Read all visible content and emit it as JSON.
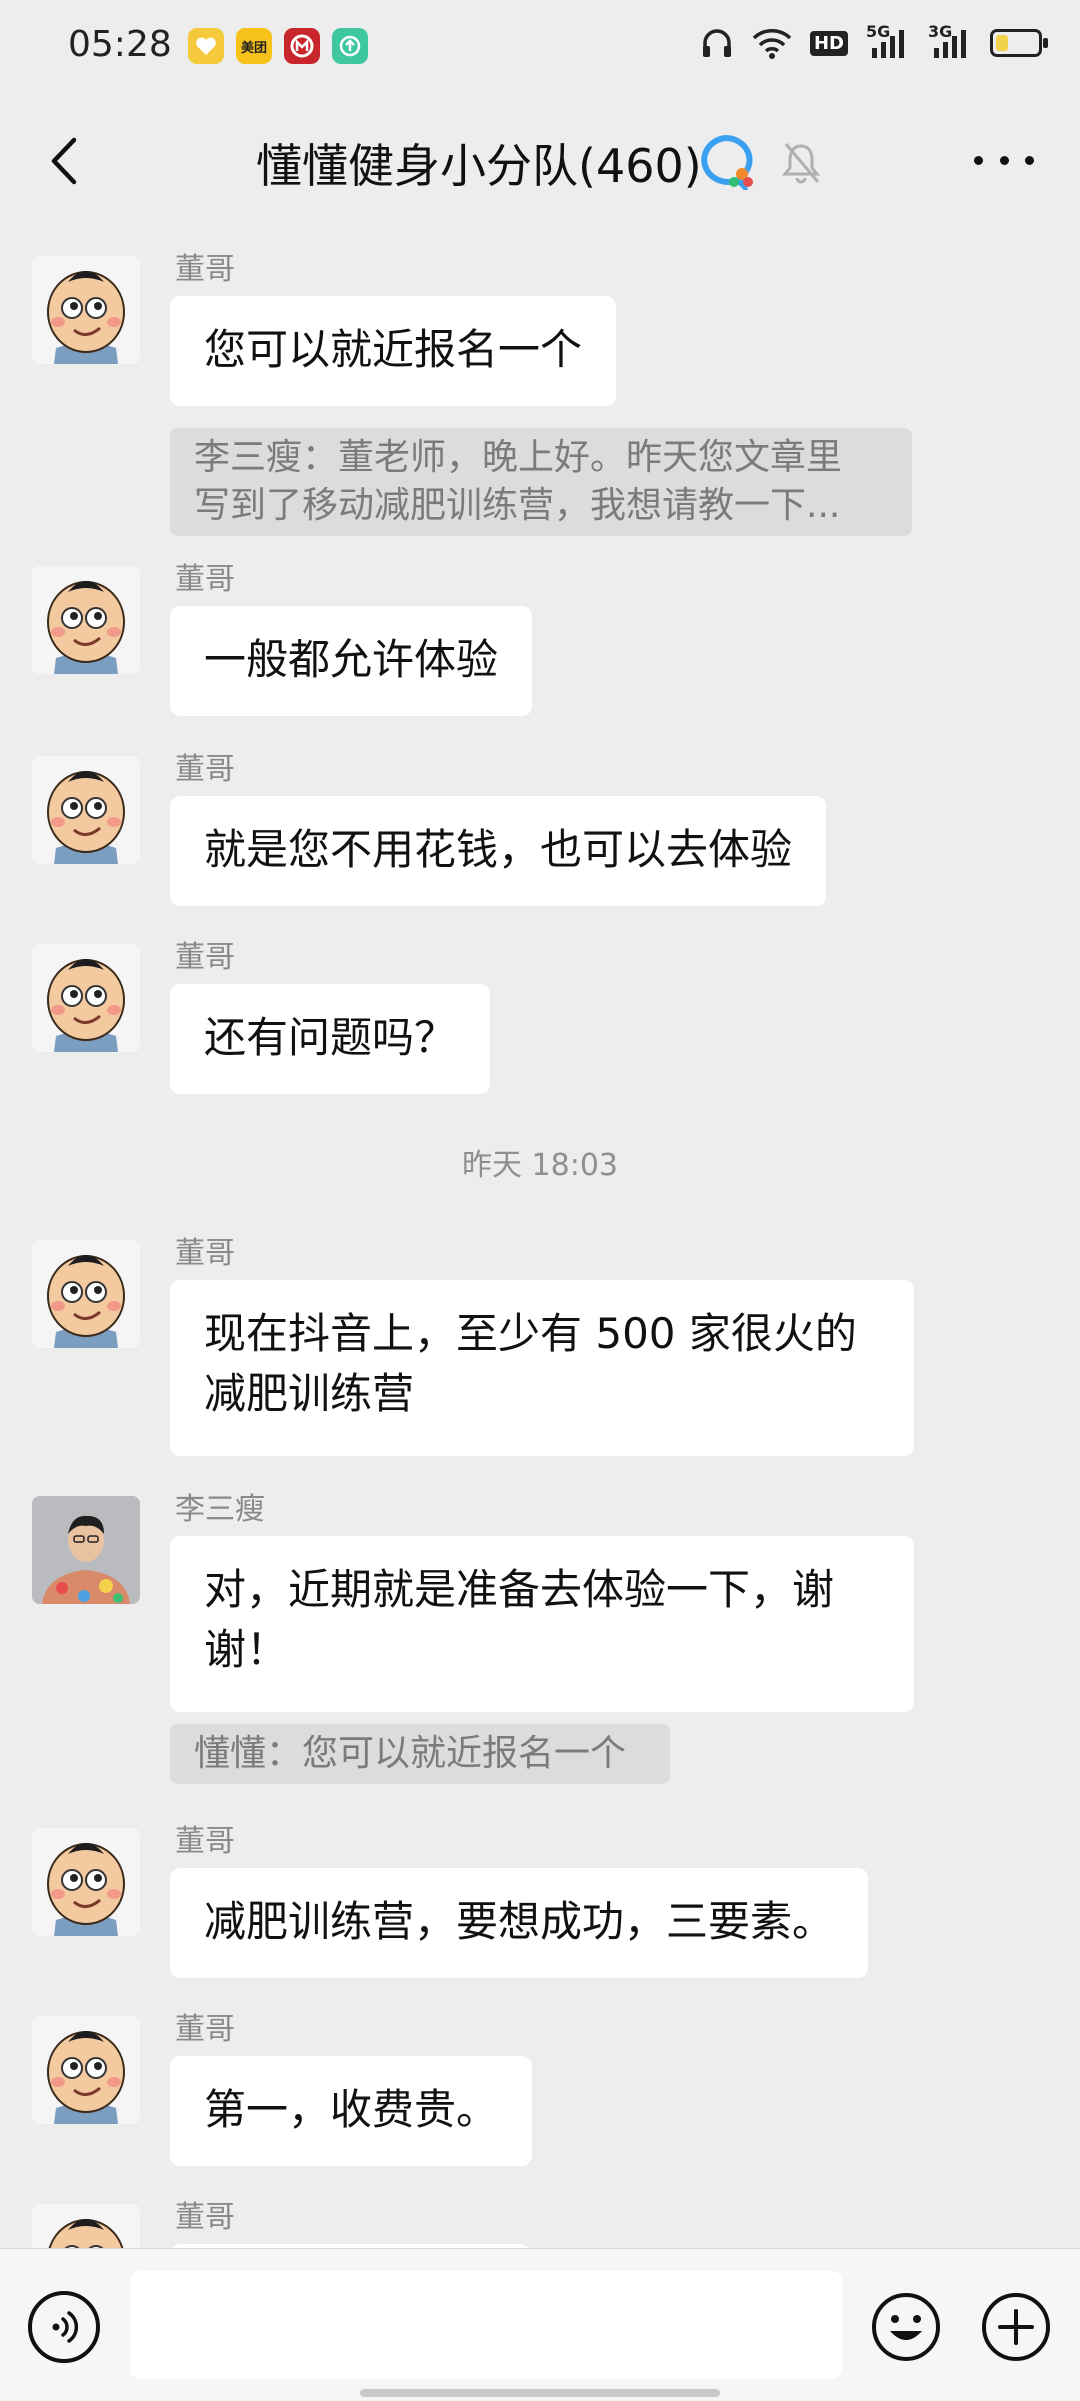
{
  "status_bar": {
    "time": "05:28",
    "app_icons": [
      {
        "icon": "heart-app-icon",
        "color": "#f6c83b",
        "label": ""
      },
      {
        "icon": "meituan-app-icon",
        "color": "#f7c31b",
        "label": "美团"
      },
      {
        "icon": "bank-app-icon",
        "color": "#c8262c",
        "label": ""
      },
      {
        "icon": "upload-app-icon",
        "color": "#3fc7a0",
        "label": ""
      }
    ],
    "network_5g": "5G",
    "network_3g": "3G",
    "hd_label": "HD",
    "battery_level": 0.3
  },
  "header": {
    "title": "懂懂健身小分队",
    "member_count": "(460)"
  },
  "messages": [
    {
      "sender": "董哥",
      "text": "您可以就近报名一个",
      "quote_lines": [
        "李三瘦：董老师，晚上好。昨天您文章里",
        "写到了移动减肥训练营，我想请教一下..."
      ]
    },
    {
      "sender": "董哥",
      "text": "一般都允许体验"
    },
    {
      "sender": "董哥",
      "text": "就是您不用花钱，也可以去体验"
    },
    {
      "sender": "董哥",
      "text": "还有问题吗？"
    },
    {
      "timestamp": "昨天 18:03"
    },
    {
      "sender": "董哥",
      "text_lines": [
        "现在抖音上，至少有 500 家很火的",
        "减肥训练营"
      ]
    },
    {
      "sender": "李三瘦",
      "text_lines": [
        "对，近期就是准备去体验一下，谢",
        "谢！"
      ],
      "quote_lines": [
        "懂懂：您可以就近报名一个"
      ]
    },
    {
      "sender": "董哥",
      "text": "减肥训练营，要想成功，三要素。"
    },
    {
      "sender": "董哥",
      "text": "第一，收费贵。"
    },
    {
      "sender": "董哥",
      "text": ""
    }
  ],
  "input": {
    "placeholder": ""
  },
  "colors": {
    "background": "#ededed",
    "bubble": "#ffffff",
    "quote": "#dcdcdc",
    "muted_text": "#8a8a8a"
  }
}
